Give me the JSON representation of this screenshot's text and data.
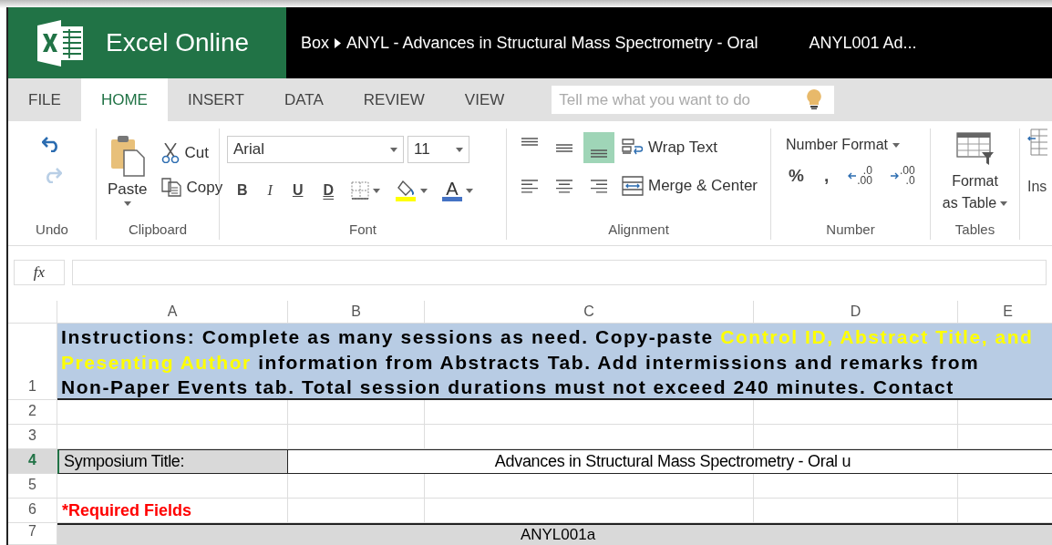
{
  "title_bar": {
    "app": "Excel Online",
    "breadcrumb": [
      "Box",
      "ANYL - Advances in Structural Mass Spectrometry - Oral"
    ],
    "file_name": "ANYL001 Ad..."
  },
  "tabs": [
    {
      "label": "FILE",
      "selected": false
    },
    {
      "label": "HOME",
      "selected": true
    },
    {
      "label": "INSERT",
      "selected": false
    },
    {
      "label": "DATA",
      "selected": false
    },
    {
      "label": "REVIEW",
      "selected": false
    },
    {
      "label": "VIEW",
      "selected": false
    }
  ],
  "search": {
    "placeholder": "Tell me what you want to do"
  },
  "ribbon": {
    "undo": {
      "label": "Undo"
    },
    "clipboard": {
      "label": "Clipboard",
      "paste": "Paste",
      "cut": "Cut",
      "copy": "Copy"
    },
    "font": {
      "label": "Font",
      "name": "Arial",
      "size": "11",
      "bold": "B",
      "italic": "I",
      "underline": "U",
      "double_underline": "D",
      "font_color": "A"
    },
    "alignment": {
      "label": "Alignment",
      "buttons": [
        {
          "kind": "top",
          "selected": false
        },
        {
          "kind": "middle",
          "selected": false
        },
        {
          "kind": "bottom",
          "selected": true
        },
        {
          "kind": "left",
          "selected": false
        },
        {
          "kind": "center",
          "selected": false
        },
        {
          "kind": "right",
          "selected": false
        }
      ],
      "wrap": "Wrap Text",
      "merge": "Merge & Center"
    },
    "number": {
      "label": "Number",
      "format": "Number Format",
      "percent": "%",
      "comma": ",",
      "decrease_decimal": [
        ".0",
        ".00"
      ],
      "increase_decimal": [
        ".00",
        ".0"
      ]
    },
    "tables": {
      "label": "Tables",
      "format_table": [
        "Format",
        "as Table"
      ]
    },
    "insert": {
      "label": "Ins"
    }
  },
  "formula_bar": {
    "function_label": "fx"
  },
  "sheet": {
    "columns": [
      "A",
      "B",
      "C",
      "D",
      "E"
    ],
    "rows": [
      {
        "number": "1",
        "kind": "instructions",
        "selected": false,
        "lines": [
          [
            {
              "text": "Instructions: Complete as many sessions as need. Copy-paste ",
              "highlight": false
            },
            {
              "text": "Control ID, Abstract Title, and",
              "highlight": true
            }
          ],
          [
            {
              "text": "Presenting Author",
              "highlight": true
            },
            {
              "text": " information from Abstracts Tab. Add intermissions and remarks from",
              "highlight": false
            }
          ],
          [
            {
              "text": "Non-Paper Events tab. Total session durations must not exceed 240 minutes. Contact",
              "highlight": false
            }
          ]
        ]
      },
      {
        "number": "2",
        "kind": "empty",
        "selected": false
      },
      {
        "number": "3",
        "kind": "empty",
        "selected": false
      },
      {
        "number": "4",
        "kind": "field",
        "selected": true,
        "label": "Symposium Title:",
        "value": "Advances in Structural Mass Spectrometry - Oral u"
      },
      {
        "number": "5",
        "kind": "empty",
        "selected": false
      },
      {
        "number": "6",
        "kind": "note",
        "selected": false,
        "text": "*Required Fields"
      },
      {
        "number": "7",
        "kind": "header",
        "selected": false,
        "text": "ANYL001a"
      }
    ]
  }
}
